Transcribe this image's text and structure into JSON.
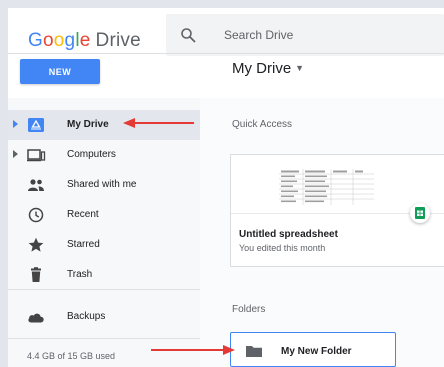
{
  "header": {
    "logo_google": "Google",
    "logo_drive": "Drive",
    "search_placeholder": "Search Drive",
    "new_label": "NEW",
    "title": "My Drive"
  },
  "sidebar": {
    "items": [
      {
        "label": "My Drive",
        "icon": "my-drive-icon",
        "active": true
      },
      {
        "label": "Computers",
        "icon": "computers-icon"
      },
      {
        "label": "Shared with me",
        "icon": "shared-icon"
      },
      {
        "label": "Recent",
        "icon": "clock-icon"
      },
      {
        "label": "Starred",
        "icon": "star-icon"
      },
      {
        "label": "Trash",
        "icon": "trash-icon"
      },
      {
        "label": "Backups",
        "icon": "cloud-icon"
      }
    ],
    "storage": "4.4 GB of 15 GB used"
  },
  "main": {
    "quick_access_label": "Quick Access",
    "file_card": {
      "name": "Untitled spreadsheet",
      "subtitle": "You edited this month"
    },
    "folders_label": "Folders",
    "folder": {
      "name": "My New Folder"
    }
  },
  "colors": {
    "accent": "#4285f4",
    "arrow": "#e53935",
    "sheets": "#0f9d58"
  }
}
